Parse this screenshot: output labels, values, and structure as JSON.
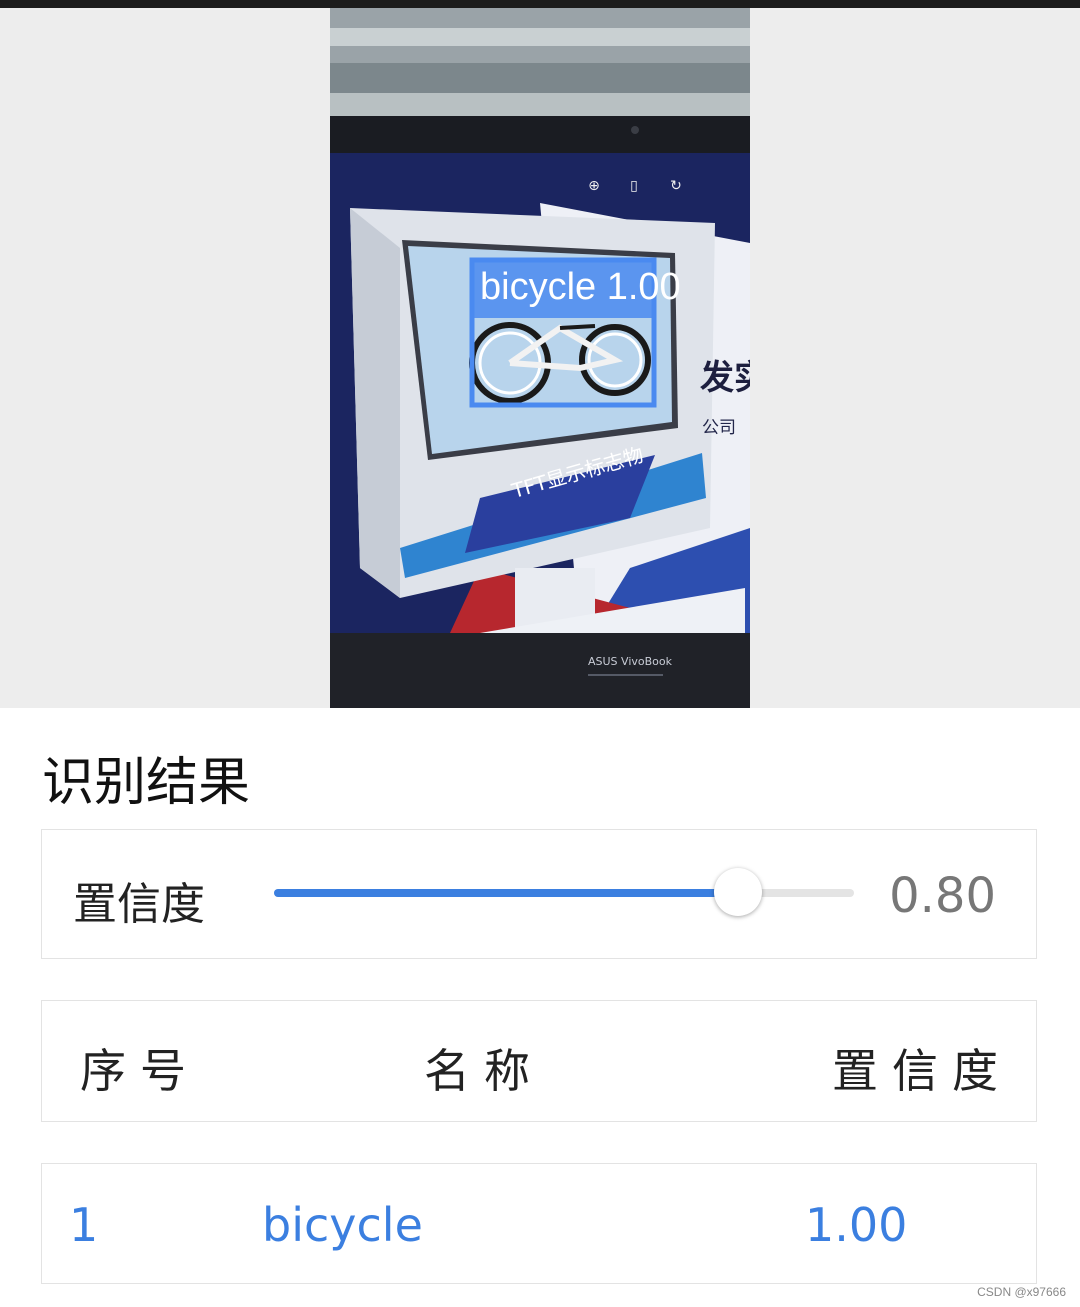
{
  "photo": {
    "detection_label": "bicycle 1.00",
    "tft_caption": "TFT显示标志物",
    "partial_banner_text": "发实",
    "partial_company_text": "公司",
    "laptop_brand": "ASUS VivoBook",
    "icons": [
      "zoom-in-icon",
      "trash-icon",
      "rotate-icon"
    ]
  },
  "result": {
    "title": "识别结果"
  },
  "confidence_slider": {
    "label": "置信度",
    "value": 0.8,
    "value_text": "0.80",
    "accent": "#3b7fe0"
  },
  "table": {
    "headers": {
      "index": "序号",
      "name": "名称",
      "confidence": "置信度"
    },
    "rows": [
      {
        "index": "1",
        "name": "bicycle",
        "confidence": "1.00"
      }
    ]
  },
  "watermark": "CSDN @x97666"
}
